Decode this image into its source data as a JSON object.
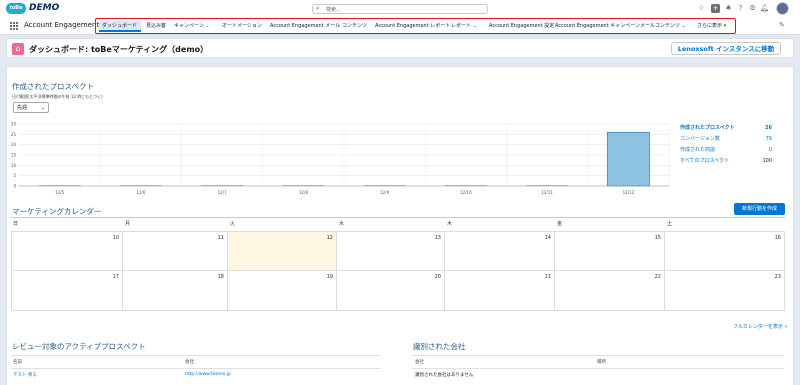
{
  "header": {
    "logo_text": "toBe",
    "brand": "DEMO",
    "search_placeholder": "検索...",
    "icons": [
      "star-icon",
      "plus-icon",
      "help-icon",
      "gear-icon",
      "bell-icon"
    ]
  },
  "nav": {
    "app_name": "Account Engagement",
    "tabs": [
      {
        "label": "ダッシュボード",
        "active": true,
        "dropdown": false
      },
      {
        "label": "見込み客",
        "active": false,
        "dropdown": false
      },
      {
        "label": "キャンペーン",
        "active": false,
        "dropdown": true
      },
      {
        "label": "オートメーション",
        "active": false,
        "dropdown": false
      },
      {
        "label": "Account Engagement メール",
        "active": false,
        "dropdown": false
      },
      {
        "label": "コンテンツ",
        "active": false,
        "dropdown": false
      },
      {
        "label": "Account Engagement レポート",
        "active": false,
        "dropdown": false
      },
      {
        "label": "レポート",
        "active": false,
        "dropdown": true
      },
      {
        "label": "Account Engagement 設定",
        "active": false,
        "dropdown": false
      },
      {
        "label": "Account Engagement キャンペーン",
        "active": false,
        "dropdown": false
      },
      {
        "label": "メールコンテンツ",
        "active": false,
        "dropdown": true
      },
      {
        "label": "さらに表示",
        "active": false,
        "dropdown": true
      }
    ]
  },
  "page": {
    "title": "ダッシュボード: toBeマーケティング（demo）",
    "instance_button": "Lenoxsoft インスタンスに移動"
  },
  "prospects": {
    "title": "作成されたプロスペクト",
    "subtitle": "日付範囲(太平洋標準時間の午前 12 時にもとづく)",
    "period": "先週",
    "legend": [
      {
        "label": "作成されたプロスペクト",
        "value": "26",
        "bold": true
      },
      {
        "label": "コンバージョン数",
        "value": "79",
        "bold": false
      },
      {
        "label": "作成された商談",
        "value": "0",
        "bold": false
      },
      {
        "label": "すべてのプロスペクト",
        "value": "100",
        "bold": false
      }
    ]
  },
  "chart_data": {
    "type": "bar",
    "categories": [
      "12/5",
      "12/6",
      "12/7",
      "12/8",
      "12/9",
      "12/10",
      "12/11",
      "12/12"
    ],
    "values": [
      0,
      0,
      0,
      0,
      0,
      0,
      0,
      26
    ],
    "yticks": [
      "0",
      "5",
      "10",
      "15",
      "20",
      "25",
      "30"
    ],
    "ylim": [
      0,
      30
    ],
    "grid": true,
    "bar_color": "#8dc3e0"
  },
  "calendar": {
    "title": "マーケティングカレンダー",
    "new_button": "新規行動を作成",
    "days_of_week": [
      "日",
      "月",
      "火",
      "水",
      "木",
      "金",
      "土"
    ],
    "week1": [
      "",
      "10",
      "11",
      "12",
      "13",
      "14",
      "15",
      "16"
    ],
    "week2": [
      "",
      "17",
      "18",
      "19",
      "20",
      "21",
      "22",
      "23"
    ],
    "full_link": "フルカレンダーを表示 »"
  },
  "active_prospects": {
    "title": "レビュー対象のアクティブプロスペクト",
    "col_name": "名前",
    "col_company": "会社",
    "row_name": "テスト 青る",
    "row_company": "http://www.tobem.jp"
  },
  "identified": {
    "title": "識別された会社",
    "col_company": "会社",
    "col_location": "場所",
    "empty": "識別された会社はありません"
  }
}
